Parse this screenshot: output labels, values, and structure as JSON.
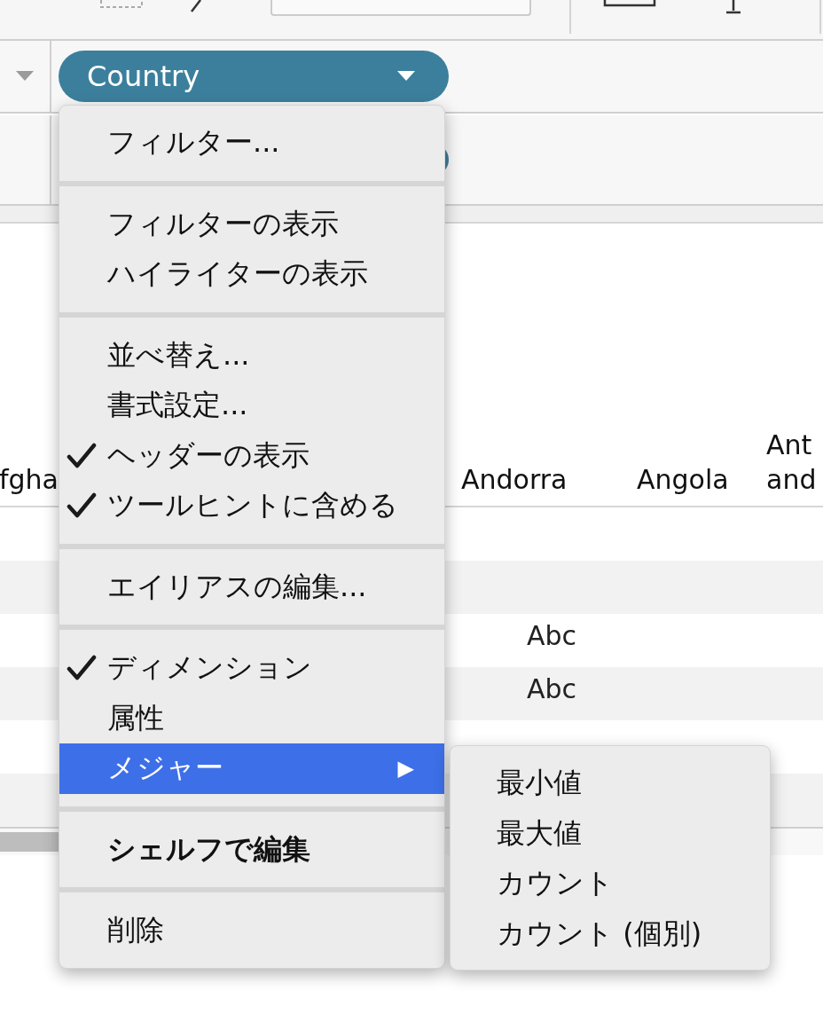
{
  "shelves": [
    {
      "pill": {
        "label": "Country"
      }
    }
  ],
  "table": {
    "columns": [
      {
        "lines": [
          "fgha"
        ]
      },
      {
        "lines": [
          "Andorra"
        ]
      },
      {
        "lines": [
          "Angola"
        ]
      },
      {
        "lines": [
          "Ant",
          "and"
        ]
      }
    ],
    "rows": [
      [
        "",
        "",
        "",
        ""
      ],
      [
        "",
        "",
        "",
        ""
      ],
      [
        "",
        "Abc",
        "",
        ""
      ],
      [
        "",
        "Abc",
        "",
        ""
      ],
      [
        "",
        "",
        "",
        ""
      ],
      [
        "",
        "",
        "",
        ""
      ]
    ]
  },
  "menu": {
    "items": [
      {
        "kind": "item",
        "label": "フィルター...",
        "checked": false,
        "selected": false,
        "bold": false
      },
      {
        "kind": "separator"
      },
      {
        "kind": "item",
        "label": "フィルターの表示",
        "checked": false,
        "selected": false,
        "bold": false
      },
      {
        "kind": "item",
        "label": "ハイライターの表示",
        "checked": false,
        "selected": false,
        "bold": false
      },
      {
        "kind": "separator"
      },
      {
        "kind": "item",
        "label": "並べ替え...",
        "checked": false,
        "selected": false,
        "bold": false
      },
      {
        "kind": "item",
        "label": "書式設定...",
        "checked": false,
        "selected": false,
        "bold": false
      },
      {
        "kind": "item",
        "label": "ヘッダーの表示",
        "checked": true,
        "selected": false,
        "bold": false
      },
      {
        "kind": "item",
        "label": "ツールヒントに含める",
        "checked": true,
        "selected": false,
        "bold": false
      },
      {
        "kind": "separator"
      },
      {
        "kind": "item",
        "label": "エイリアスの編集...",
        "checked": false,
        "selected": false,
        "bold": false
      },
      {
        "kind": "separator"
      },
      {
        "kind": "item",
        "label": "ディメンション",
        "checked": true,
        "selected": false,
        "bold": false
      },
      {
        "kind": "item",
        "label": "属性",
        "checked": false,
        "selected": false,
        "bold": false
      },
      {
        "kind": "submenu",
        "label": "メジャー",
        "checked": false,
        "selected": true,
        "bold": false,
        "arrow": "▶"
      },
      {
        "kind": "separator"
      },
      {
        "kind": "item",
        "label": "シェルフで編集",
        "checked": false,
        "selected": false,
        "bold": true
      },
      {
        "kind": "separator"
      },
      {
        "kind": "item",
        "label": "削除",
        "checked": false,
        "selected": false,
        "bold": false
      }
    ]
  },
  "submenu": {
    "items": [
      {
        "label": "最小値"
      },
      {
        "label": "最大値"
      },
      {
        "label": "カウント"
      },
      {
        "label": "カウント (個別)"
      }
    ]
  }
}
